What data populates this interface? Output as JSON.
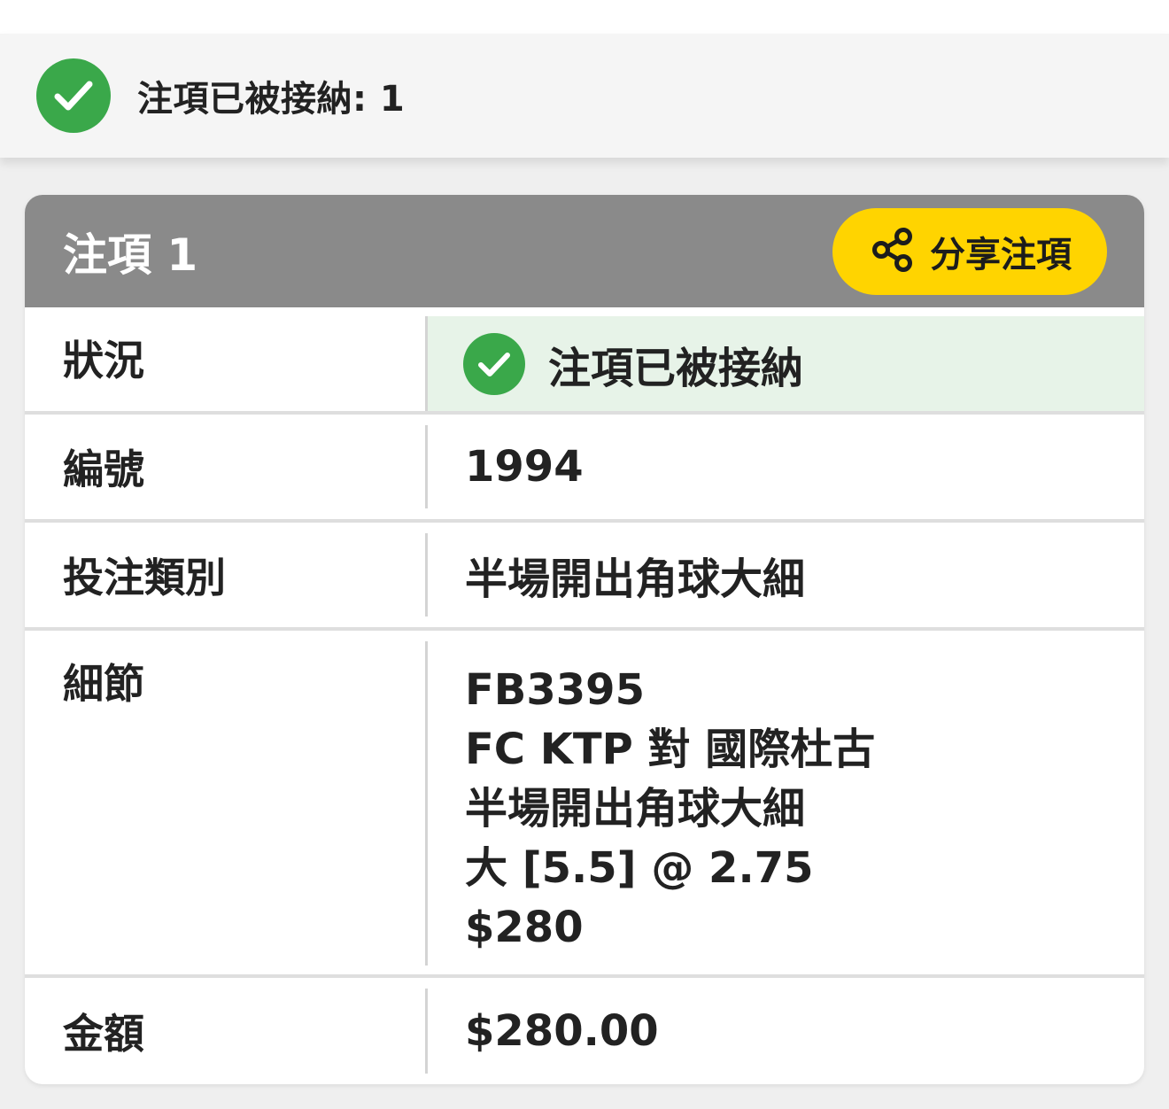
{
  "summary": {
    "accepted_text": "注項已被接納: 1"
  },
  "bet_card": {
    "title": "注項 1",
    "share_label": "分享注項",
    "rows": {
      "status": {
        "label": "狀況",
        "value": "注項已被接納"
      },
      "ref_no": {
        "label": "編號",
        "value": "1994"
      },
      "bet_type": {
        "label": "投注類別",
        "value": "半場開出角球大細"
      },
      "details": {
        "label": "細節",
        "lines": [
          "FB3395",
          "FC KTP 對 國際杜古",
          "半場開出角球大細",
          "大 [5.5] @ 2.75",
          "$280"
        ]
      },
      "amount": {
        "label": "金額",
        "value": "$280.00"
      }
    }
  },
  "colors": {
    "accent_yellow": "#ffd400",
    "success_green": "#3aa84a",
    "header_gray": "#8a8a8a",
    "status_bg": "#e7f3e8"
  },
  "icons": {
    "success": "check-circle-icon",
    "share": "share-icon"
  }
}
